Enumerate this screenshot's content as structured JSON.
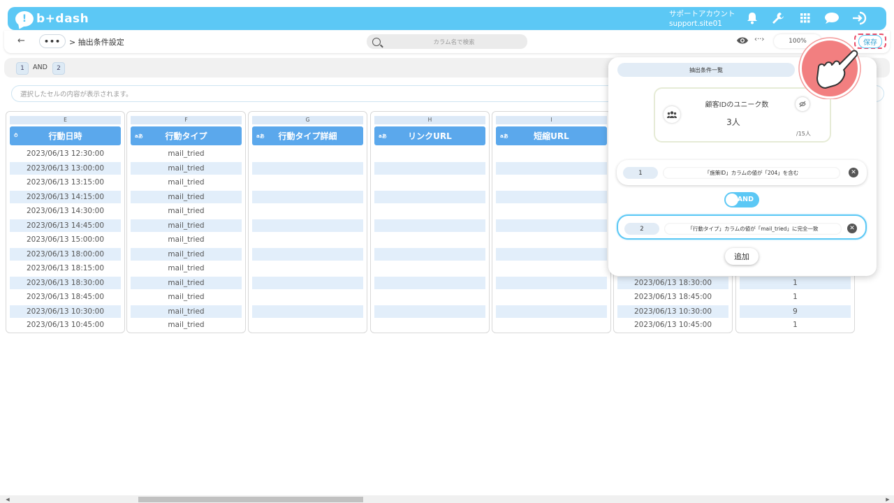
{
  "app": {
    "logo_text": "b+dash",
    "logo_mark": "!"
  },
  "account": {
    "name": "サポートアカウント",
    "site": "support.site01"
  },
  "toolbar": {
    "back_glyph": "←",
    "more_glyph": "•••",
    "breadcrumb": "> 抽出条件設定",
    "search_placeholder": "カラム名で検索",
    "zoom": "100%",
    "arrows_glyph": "‹··›",
    "save_label": "保存"
  },
  "condition_summary": {
    "left": "1",
    "op": "AND",
    "right": "2"
  },
  "cell_viewer_placeholder": "選択したセルの内容が表示されます。",
  "columns": [
    {
      "letter": "E",
      "title": "行動日時",
      "type_icon": "⏱",
      "cells": [
        "2023/06/13 12:30:00",
        "2023/06/13 13:00:00",
        "2023/06/13 13:15:00",
        "2023/06/13 14:15:00",
        "2023/06/13 14:30:00",
        "2023/06/13 14:45:00",
        "2023/06/13 15:00:00",
        "2023/06/13 18:00:00",
        "2023/06/13 18:15:00",
        "2023/06/13 18:30:00",
        "2023/06/13 18:45:00",
        "2023/06/13 10:30:00",
        "2023/06/13 10:45:00"
      ]
    },
    {
      "letter": "F",
      "title": "行動タイプ",
      "type_icon": "aあ",
      "cells": [
        "mail_tried",
        "mail_tried",
        "mail_tried",
        "mail_tried",
        "mail_tried",
        "mail_tried",
        "mail_tried",
        "mail_tried",
        "mail_tried",
        "mail_tried",
        "mail_tried",
        "mail_tried",
        "mail_tried"
      ]
    },
    {
      "letter": "G",
      "title": "行動タイプ詳細",
      "type_icon": "aあ",
      "cells": [
        "",
        "",
        "",
        "",
        "",
        "",
        "",
        "",
        "",
        "",
        "",
        "",
        ""
      ]
    },
    {
      "letter": "H",
      "title": "リンクURL",
      "type_icon": "aあ",
      "cells": [
        "",
        "",
        "",
        "",
        "",
        "",
        "",
        "",
        "",
        "",
        "",
        "",
        ""
      ]
    },
    {
      "letter": "I",
      "title": "短縮URL",
      "type_icon": "aあ",
      "cells": [
        "",
        "",
        "",
        "",
        "",
        "",
        "",
        "",
        "",
        "",
        "",
        "",
        ""
      ]
    },
    {
      "letter": "",
      "title": "",
      "type_icon": "",
      "cells": [
        "",
        "",
        "",
        "",
        "",
        "",
        "",
        "",
        "",
        "2023/06/13 18:30:00",
        "2023/06/13 18:45:00",
        "2023/06/13 10:30:00",
        "2023/06/13 10:45:00"
      ]
    },
    {
      "letter": "",
      "title": "",
      "type_icon": "",
      "cells": [
        "",
        "",
        "",
        "",
        "",
        "",
        "",
        "",
        "",
        "1",
        "1",
        "9",
        "1"
      ]
    }
  ],
  "panel": {
    "title": "抽出条件一覧",
    "count_label": "顧客IDのユニーク数",
    "count_value": "3人",
    "count_total": "/15人",
    "conditions": [
      {
        "num": "1",
        "text": "「施策ID」カラムの値が「204」を含む"
      },
      {
        "num": "2",
        "text": "「行動タイプ」カラムの値が「mail_tried」に完全一致"
      }
    ],
    "toggle_label": "AND",
    "add_label": "追加"
  },
  "colors": {
    "brand": "#5cc8f5",
    "header_blue": "#5ba8ec",
    "highlight": "#e94e6a"
  },
  "icons": [
    "bell-icon",
    "wrench-icon",
    "grid-icon",
    "chat-icon",
    "logout-icon",
    "eye-icon",
    "search-icon",
    "users-icon",
    "close-icon",
    "hand-pointer-icon"
  ]
}
